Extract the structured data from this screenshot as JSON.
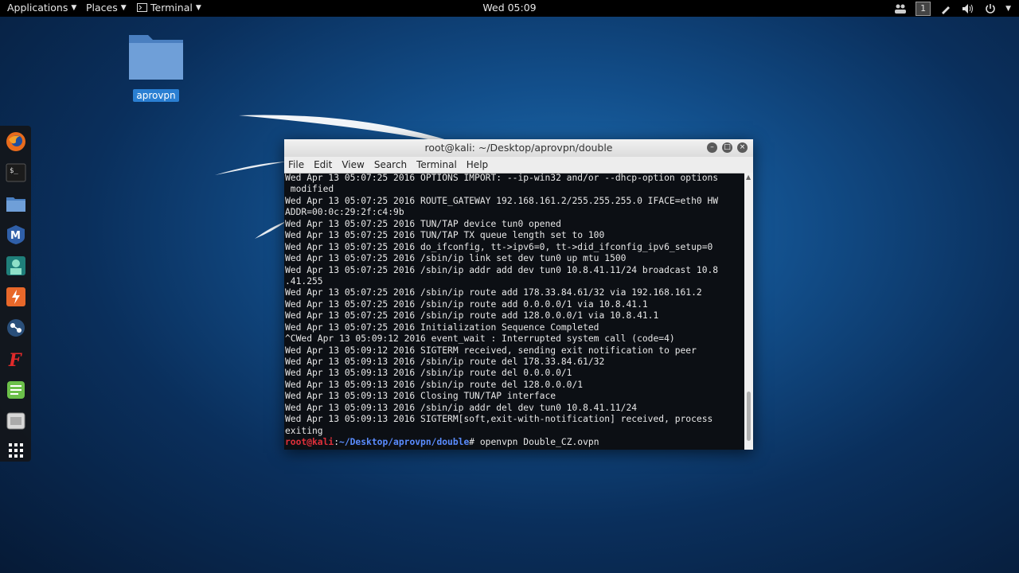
{
  "topbar": {
    "applications": "Applications",
    "places": "Places",
    "terminal": "Terminal",
    "clock": "Wed 05:09",
    "workspace": "1"
  },
  "desktop": {
    "folder_label": "aprovpn"
  },
  "dock": {
    "items": [
      "firefox-icon",
      "terminal-icon",
      "files-icon",
      "metasploit-icon",
      "armitage-icon",
      "burpsuite-icon",
      "maltego-icon",
      "faraday-icon",
      "leafpad-icon",
      "cherrytree-icon",
      "show-apps-icon"
    ]
  },
  "window": {
    "title": "root@kali: ~/Desktop/aprovpn/double",
    "menu": [
      "File",
      "Edit",
      "View",
      "Search",
      "Terminal",
      "Help"
    ],
    "lines": [
      "Wed Apr 13 05:07:25 2016 OPTIONS IMPORT: --ip-win32 and/or --dhcp-option options",
      " modified",
      "Wed Apr 13 05:07:25 2016 ROUTE_GATEWAY 192.168.161.2/255.255.255.0 IFACE=eth0 HW",
      "ADDR=00:0c:29:2f:c4:9b",
      "Wed Apr 13 05:07:25 2016 TUN/TAP device tun0 opened",
      "Wed Apr 13 05:07:25 2016 TUN/TAP TX queue length set to 100",
      "Wed Apr 13 05:07:25 2016 do_ifconfig, tt->ipv6=0, tt->did_ifconfig_ipv6_setup=0",
      "Wed Apr 13 05:07:25 2016 /sbin/ip link set dev tun0 up mtu 1500",
      "Wed Apr 13 05:07:25 2016 /sbin/ip addr add dev tun0 10.8.41.11/24 broadcast 10.8",
      ".41.255",
      "Wed Apr 13 05:07:25 2016 /sbin/ip route add 178.33.84.61/32 via 192.168.161.2",
      "Wed Apr 13 05:07:25 2016 /sbin/ip route add 0.0.0.0/1 via 10.8.41.1",
      "Wed Apr 13 05:07:25 2016 /sbin/ip route add 128.0.0.0/1 via 10.8.41.1",
      "Wed Apr 13 05:07:25 2016 Initialization Sequence Completed",
      "^CWed Apr 13 05:09:12 2016 event_wait : Interrupted system call (code=4)",
      "Wed Apr 13 05:09:12 2016 SIGTERM received, sending exit notification to peer",
      "Wed Apr 13 05:09:13 2016 /sbin/ip route del 178.33.84.61/32",
      "Wed Apr 13 05:09:13 2016 /sbin/ip route del 0.0.0.0/1",
      "Wed Apr 13 05:09:13 2016 /sbin/ip route del 128.0.0.0/1",
      "Wed Apr 13 05:09:13 2016 Closing TUN/TAP interface",
      "Wed Apr 13 05:09:13 2016 /sbin/ip addr del dev tun0 10.8.41.11/24",
      "Wed Apr 13 05:09:13 2016 SIGTERM[soft,exit-with-notification] received, process",
      "exiting"
    ],
    "prompt": {
      "user": "root@kali",
      "sep": ":",
      "path": "~/Desktop/aprovpn/double",
      "symbol": "# ",
      "command": "openvpn Double_CZ.ovpn"
    }
  }
}
